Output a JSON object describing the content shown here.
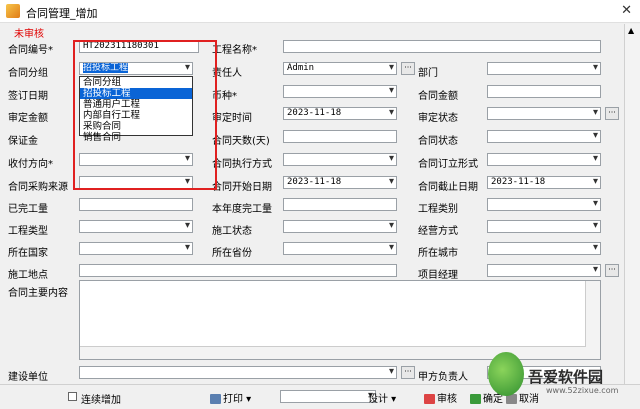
{
  "window": {
    "title": "合同管理_增加",
    "close_icon": "close-icon"
  },
  "status": "未审核",
  "fields": {
    "contract_no": {
      "label": "合同编号*",
      "value": "HT202311180301"
    },
    "project_name": {
      "label": "工程名称*",
      "value": ""
    },
    "contract_group": {
      "label": "合同分组",
      "value": "招投标工程"
    },
    "responsible": {
      "label": "责任人",
      "value": "Admin"
    },
    "department": {
      "label": "部门",
      "value": ""
    },
    "sign_date": {
      "label": "签订日期",
      "value": ""
    },
    "currency": {
      "label": "币种*",
      "value": ""
    },
    "contract_amount": {
      "label": "合同金额",
      "value": ""
    },
    "approved_amount": {
      "label": "审定金额",
      "value": ""
    },
    "approve_time": {
      "label": "审定时间",
      "value": "2023-11-18"
    },
    "approve_status": {
      "label": "审定状态",
      "value": ""
    },
    "deposit": {
      "label": "保证金",
      "value": ""
    },
    "contract_days": {
      "label": "合同天数(天)",
      "value": ""
    },
    "contract_status": {
      "label": "合同状态",
      "value": ""
    },
    "payment_direction": {
      "label": "收付方向*",
      "value": ""
    },
    "execution_mode": {
      "label": "合同执行方式",
      "value": ""
    },
    "signing_form": {
      "label": "合同订立形式",
      "value": ""
    },
    "purchase_source": {
      "label": "合同采购来源",
      "value": ""
    },
    "start_date": {
      "label": "合同开始日期",
      "value": "2023-11-18"
    },
    "end_date": {
      "label": "合同截止日期",
      "value": "2023-11-18"
    },
    "completed_work": {
      "label": "已完工量",
      "value": ""
    },
    "year_completed": {
      "label": "本年度完工量",
      "value": ""
    },
    "project_category": {
      "label": "工程类别",
      "value": ""
    },
    "project_type": {
      "label": "工程类型",
      "value": ""
    },
    "construction_status": {
      "label": "施工状态",
      "value": ""
    },
    "operation_mode": {
      "label": "经营方式",
      "value": ""
    },
    "country": {
      "label": "所在国家",
      "value": ""
    },
    "province": {
      "label": "所在省份",
      "value": ""
    },
    "city": {
      "label": "所在城市",
      "value": ""
    },
    "site": {
      "label": "施工地点",
      "value": ""
    },
    "project_manager": {
      "label": "项目经理",
      "value": ""
    },
    "main_content": {
      "label": "合同主要内容",
      "value": ""
    },
    "builder": {
      "label": "建设单位",
      "value": ""
    },
    "party_a_owner": {
      "label": "甲方负责人",
      "value": ""
    }
  },
  "dropdown": {
    "options": [
      "合同分组",
      "招投标工程",
      "普通用户工程",
      "内部自行工程",
      "采购合同",
      "销售合同"
    ],
    "selected_index": 1
  },
  "bottom": {
    "continuous_add": "连续增加",
    "print": "打印",
    "design": "设计",
    "audit": "审核",
    "confirm": "确定",
    "cancel": "取消"
  },
  "watermark": {
    "text": "吾爱软件园",
    "url": "www.52zixue.com"
  },
  "colors": {
    "status_red": "#e00000",
    "highlight_blue": "#0a64d6",
    "annotation_red": "#e02020"
  }
}
